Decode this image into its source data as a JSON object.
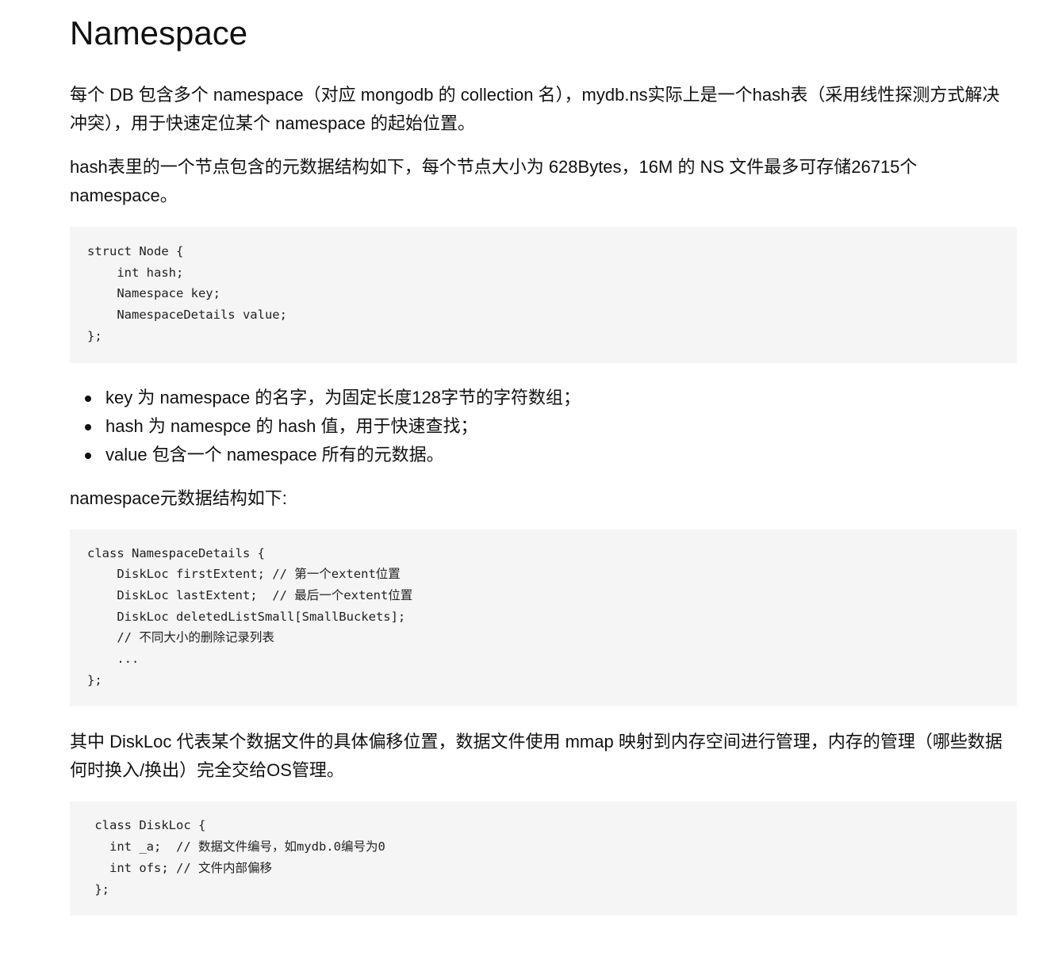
{
  "title": "Namespace",
  "paragraphs": {
    "intro": "每个 DB 包含多个 namespace（对应 mongodb 的 collection 名），mydb.ns实际上是一个hash表（采用线性探测方式解决冲突），用于快速定位某个 namespace 的起始位置。",
    "node_desc": "hash表里的一个节点包含的元数据结构如下，每个节点大小为 628Bytes，16M 的 NS 文件最多可存储26715个namespace。",
    "ns_meta": "namespace元数据结构如下:",
    "diskloc_desc": "其中 DiskLoc 代表某个数据文件的具体偏移位置，数据文件使用 mmap 映射到内存空间进行管理，内存的管理（哪些数据何时换入/换出）完全交给OS管理。"
  },
  "code": {
    "node_struct": "struct Node {\n    int hash;\n    Namespace key;\n    NamespaceDetails value;\n};",
    "namespace_details": "class NamespaceDetails {\n    DiskLoc firstExtent; // 第一个extent位置\n    DiskLoc lastExtent;  // 最后一个extent位置\n    DiskLoc deletedListSmall[SmallBuckets];\n    // 不同大小的删除记录列表\n    ...\n};",
    "diskloc": " class DiskLoc {\n   int _a;  // 数据文件编号，如mydb.0编号为0\n   int ofs; // 文件内部偏移\n };"
  },
  "bullets": [
    "key 为 namespace 的名字，为固定长度128字节的字符数组；",
    "hash 为 namespce 的 hash 值，用于快速查找；",
    "value 包含一个 namespace 所有的元数据。"
  ]
}
